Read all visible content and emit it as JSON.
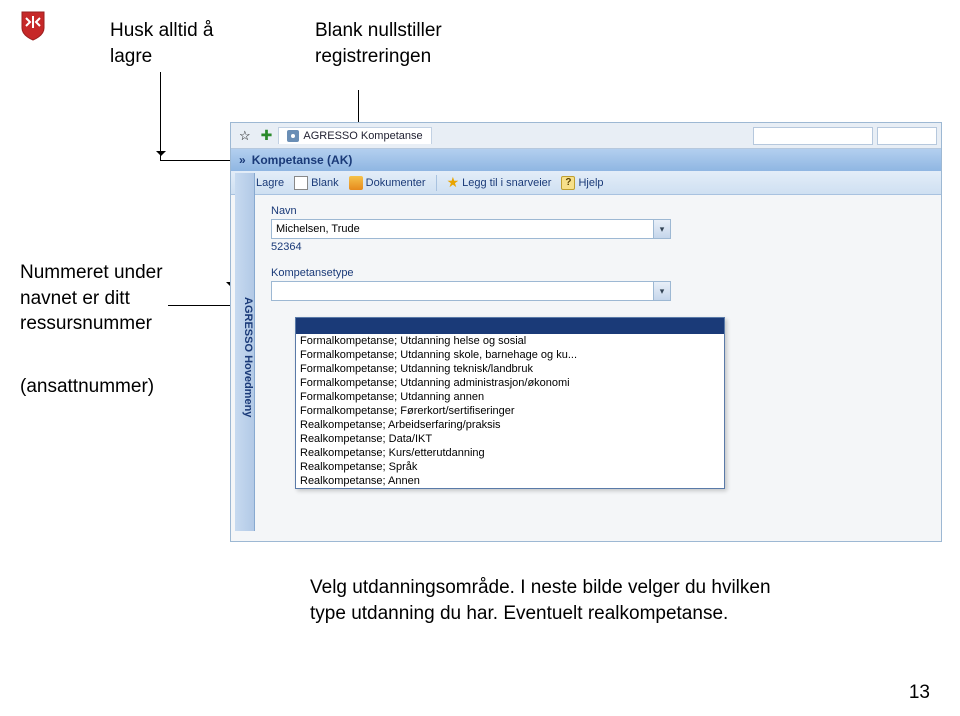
{
  "logo": {
    "name": "shield-logo"
  },
  "callouts": {
    "remember_save": "Husk alltid å lagre",
    "blank_resets": "Blank nullstiller registreringen",
    "number_under_name": "Nummeret under navnet er ditt ressursnummer",
    "employee_number": "(ansattnummer)",
    "choose_area": "Velg utdanningsområde. I neste bilde velger du hvilken type utdanning du har. Eventuelt realkompetanse."
  },
  "app": {
    "tab_label": "AGRESSO Kompetanse",
    "title": "Kompetanse (AK)",
    "toolbar": {
      "save": "Lagre",
      "blank": "Blank",
      "documents": "Dokumenter",
      "add_shortcut": "Legg til i snarveier",
      "help": "Hjelp"
    },
    "sidemenu": "AGRESSO Hovedmeny",
    "form": {
      "name_label": "Navn",
      "name_value": "Michelsen, Trude",
      "resource_number": "52364",
      "kompetansetype_label": "Kompetansetype",
      "kompetansetype_value": ""
    },
    "dropdown_options": [
      "Formalkompetanse; Utdanning helse og sosial",
      "Formalkompetanse; Utdanning skole, barnehage og ku...",
      "Formalkompetanse; Utdanning teknisk/landbruk",
      "Formalkompetanse; Utdanning administrasjon/økonomi",
      "Formalkompetanse; Utdanning annen",
      "Formalkompetanse; Førerkort/sertifiseringer",
      "Realkompetanse; Arbeidserfaring/praksis",
      "Realkompetanse; Data/IKT",
      "Realkompetanse; Kurs/etterutdanning",
      "Realkompetanse; Språk",
      "Realkompetanse; Annen"
    ]
  },
  "page_number": "13"
}
